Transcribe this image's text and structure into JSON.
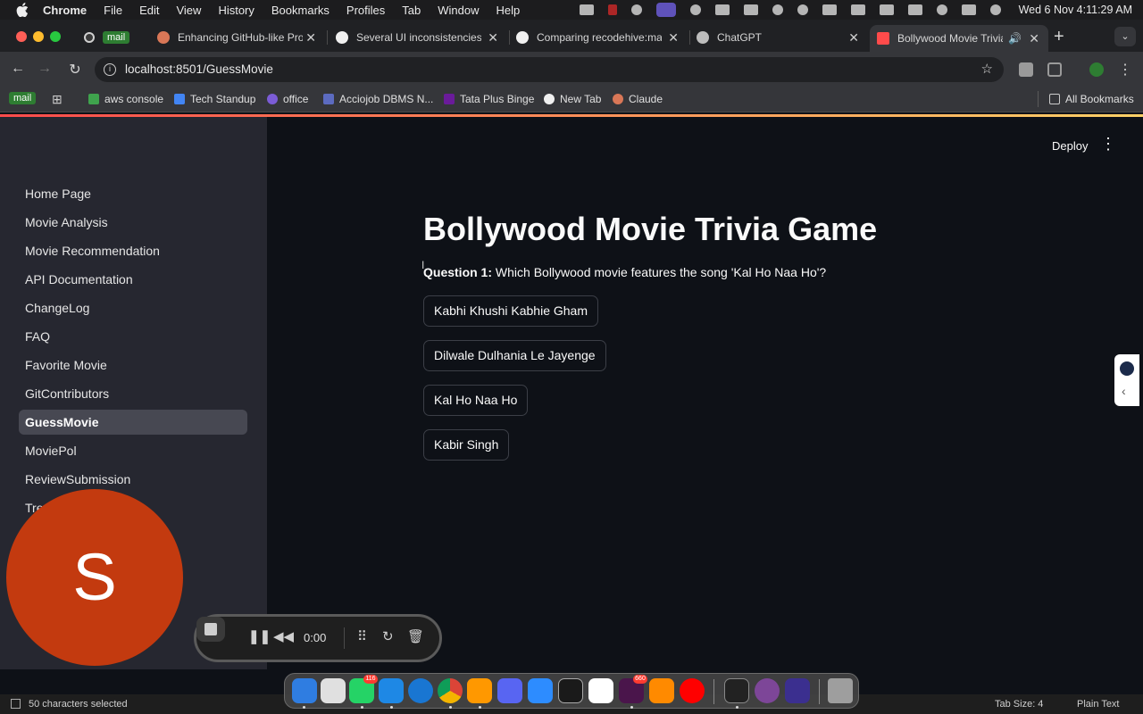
{
  "menubar": {
    "app": "Chrome",
    "items": [
      "File",
      "Edit",
      "View",
      "History",
      "Bookmarks",
      "Profiles",
      "Tab",
      "Window",
      "Help"
    ],
    "clock": "Wed 6 Nov  4:11:29 AM"
  },
  "tabs": [
    {
      "title": "mail",
      "kind": "pill"
    },
    {
      "title": "Enhancing GitHub-like Proje",
      "icon": "claude-icon",
      "color": "#d97757"
    },
    {
      "title": "Several UI inconsistencies a",
      "icon": "github-icon",
      "color": "#f0f0f0"
    },
    {
      "title": "Comparing recodehive:mair",
      "icon": "github-icon",
      "color": "#f0f0f0"
    },
    {
      "title": "ChatGPT",
      "icon": "chatgpt-icon",
      "color": "#bdbdbd"
    },
    {
      "title": "Bollywood Movie Trivia",
      "icon": "streamlit-icon",
      "color": "#ff4b4b",
      "active": true
    }
  ],
  "url": "localhost:8501/GuessMovie",
  "bookmarks": [
    {
      "label": "mail",
      "kind": "pill"
    },
    {
      "label": "aws console",
      "color": "#3fa34d"
    },
    {
      "label": "Tech Standup",
      "color": "#4285f4"
    },
    {
      "label": "office",
      "color": "#7b5cd6"
    },
    {
      "label": "Acciojob DBMS N...",
      "color": "#5c6bc0"
    },
    {
      "label": "Tata Plus Binge",
      "color": "#6a1b9a"
    },
    {
      "label": "New Tab",
      "color": "#f0f0f0"
    },
    {
      "label": "Claude",
      "color": "#d97757"
    }
  ],
  "all_bookmarks": "All Bookmarks",
  "sidebar": {
    "items": [
      {
        "label": "Home Page"
      },
      {
        "label": "Movie Analysis"
      },
      {
        "label": "Movie Recommendation"
      },
      {
        "label": "API Documentation"
      },
      {
        "label": "ChangeLog"
      },
      {
        "label": "FAQ"
      },
      {
        "label": "Favorite Movie"
      },
      {
        "label": "GitContributors"
      },
      {
        "label": "GuessMovie",
        "active": true
      },
      {
        "label": "MoviePol"
      },
      {
        "label": "ReviewSubmission"
      },
      {
        "label": "Tre"
      }
    ]
  },
  "header": {
    "deploy": "Deploy",
    "menu": "⋮"
  },
  "main": {
    "title": "Bollywood Movie Trivia Game",
    "question_prefix": "Question 1:",
    "question_text": " Which Bollywood movie features the song 'Kal Ho Naa Ho'?",
    "options": [
      "Kabhi Khushi Kabhie Gham",
      "Dilwale Dulhania Le Jayenge",
      "Kal Ho Naa Ho",
      "Kabir Singh"
    ]
  },
  "avatar_letter": "S",
  "recorder": {
    "time": "0:00"
  },
  "statusbar": {
    "selection": "50 characters selected",
    "tab_size": "Tab Size: 4",
    "language": "Plain Text"
  },
  "dock": {
    "apps": [
      {
        "name": "finder",
        "color": "#2f7de1"
      },
      {
        "name": "launchpad",
        "color": "#e0e0e0"
      },
      {
        "name": "whatsapp",
        "color": "#25d366",
        "badge": "116"
      },
      {
        "name": "vscode",
        "color": "#1e88e5"
      },
      {
        "name": "safari",
        "color": "#1976d2"
      },
      {
        "name": "chrome",
        "color": "#fbc02d"
      },
      {
        "name": "sublime",
        "color": "#ff9800"
      },
      {
        "name": "discord",
        "color": "#5865f2"
      },
      {
        "name": "zoom",
        "color": "#2d8cff"
      },
      {
        "name": "pycharm",
        "color": "#1a1a1a"
      },
      {
        "name": "notion",
        "color": "#ffffff"
      },
      {
        "name": "slack",
        "color": "#4a154b",
        "badge": "660"
      },
      {
        "name": "pages",
        "color": "#ff8a00"
      },
      {
        "name": "youtube",
        "color": "#ff0000"
      },
      {
        "name": "terminal",
        "color": "#222222"
      },
      {
        "name": "tor",
        "color": "#7d4698"
      },
      {
        "name": "arc",
        "color": "#3b2f8f"
      },
      {
        "name": "trash",
        "color": "#9e9e9e"
      }
    ]
  }
}
